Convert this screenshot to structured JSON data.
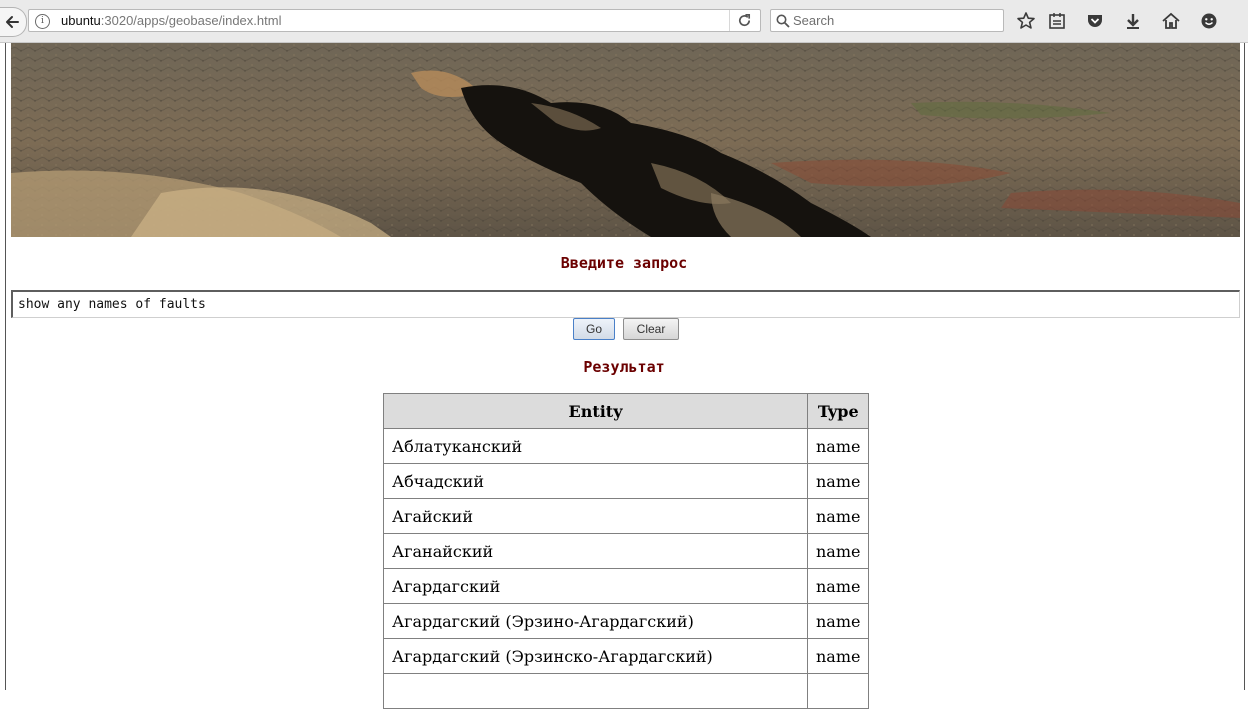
{
  "browser": {
    "url_host": "ubuntu",
    "url_rest": ":3020/apps/geobase/index.html",
    "search_placeholder": "Search",
    "icons": [
      "back-arrow-icon",
      "info-icon",
      "reload-icon",
      "search-icon",
      "bookmark-star-icon",
      "reading-list-icon",
      "pocket-icon",
      "download-icon",
      "home-icon",
      "smiley-icon"
    ]
  },
  "banner": {
    "alt": "Canyon landscape photo"
  },
  "query": {
    "heading": "Введите запрос",
    "value": "show any names of faults",
    "go_label": "Go",
    "clear_label": "Clear"
  },
  "results": {
    "heading": "Результат",
    "columns": [
      "Entity",
      "Type"
    ],
    "rows": [
      [
        "Аблатуканский",
        "name"
      ],
      [
        "Абчадский",
        "name"
      ],
      [
        "Агайский",
        "name"
      ],
      [
        "Аганайский",
        "name"
      ],
      [
        "Агардагский",
        "name"
      ],
      [
        "Агардагский (Эрзино-Агардагский)",
        "name"
      ],
      [
        "Агардагский (Эрзинско-Агардагский)",
        "name"
      ],
      [
        "",
        ""
      ]
    ]
  },
  "colors": {
    "heading": "#6b0000",
    "table_header_bg": "#dcdcdc"
  }
}
